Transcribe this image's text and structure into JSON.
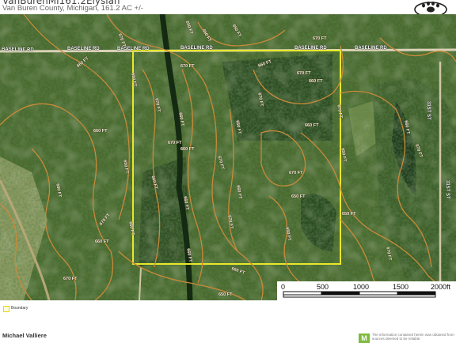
{
  "header": {
    "title": "VanBurenMI161.2Elysian",
    "subtitle": "Van Buren County, Michigan, 161.2 AC +/-",
    "logo_icon": "paw-print-icon"
  },
  "map": {
    "type": "satellite-aerial-parcel-map",
    "boundary_color": "#e8e82a",
    "contour_color": "#c98a3a",
    "roads": [
      {
        "label": "BASELINE RD"
      },
      {
        "label": "BASELINE RD"
      },
      {
        "label": "BASELINE RD"
      },
      {
        "label": "BASELINE RD"
      },
      {
        "label": "BASELINE RD"
      },
      {
        "label": "BASELINE RD"
      },
      {
        "label": "31ST ST"
      },
      {
        "label": "31ST ST"
      }
    ],
    "contour_labels": [
      "650 FT",
      "660 FT",
      "650 FT",
      "670 FT",
      "670 FT",
      "660 FT",
      "650 FT",
      "670 FT",
      "660 FT",
      "670 FT",
      "660 FT",
      "670 FT",
      "660 FT",
      "670 FT",
      "670 FT",
      "660 FT",
      "650 FT",
      "660 FT",
      "670 FT",
      "660 FT",
      "670 FT",
      "650 FT",
      "650 FT",
      "660 FT",
      "670 FT",
      "660 FT",
      "670 FT",
      "660 FT",
      "680 FT",
      "670 FT",
      "660 FT",
      "650 FT",
      "670 FT",
      "650 FT",
      "660 FT",
      "660 FT",
      "650 FT",
      "660 FT",
      "670 FT",
      "660 FT",
      "670 FT",
      "650 FT"
    ]
  },
  "scale_bar": {
    "ticks": [
      "0",
      "500",
      "1000",
      "1500",
      "2000ft"
    ]
  },
  "legend": {
    "boundary_label": "Boundary",
    "boundary_icon": "boundary-swatch-icon"
  },
  "footer": {
    "agent_name": "Michael Valliere",
    "agent_contact": "",
    "badge_letter": "M",
    "disclaimer": "The information contained herein was obtained from sources deemed to be reliable."
  }
}
